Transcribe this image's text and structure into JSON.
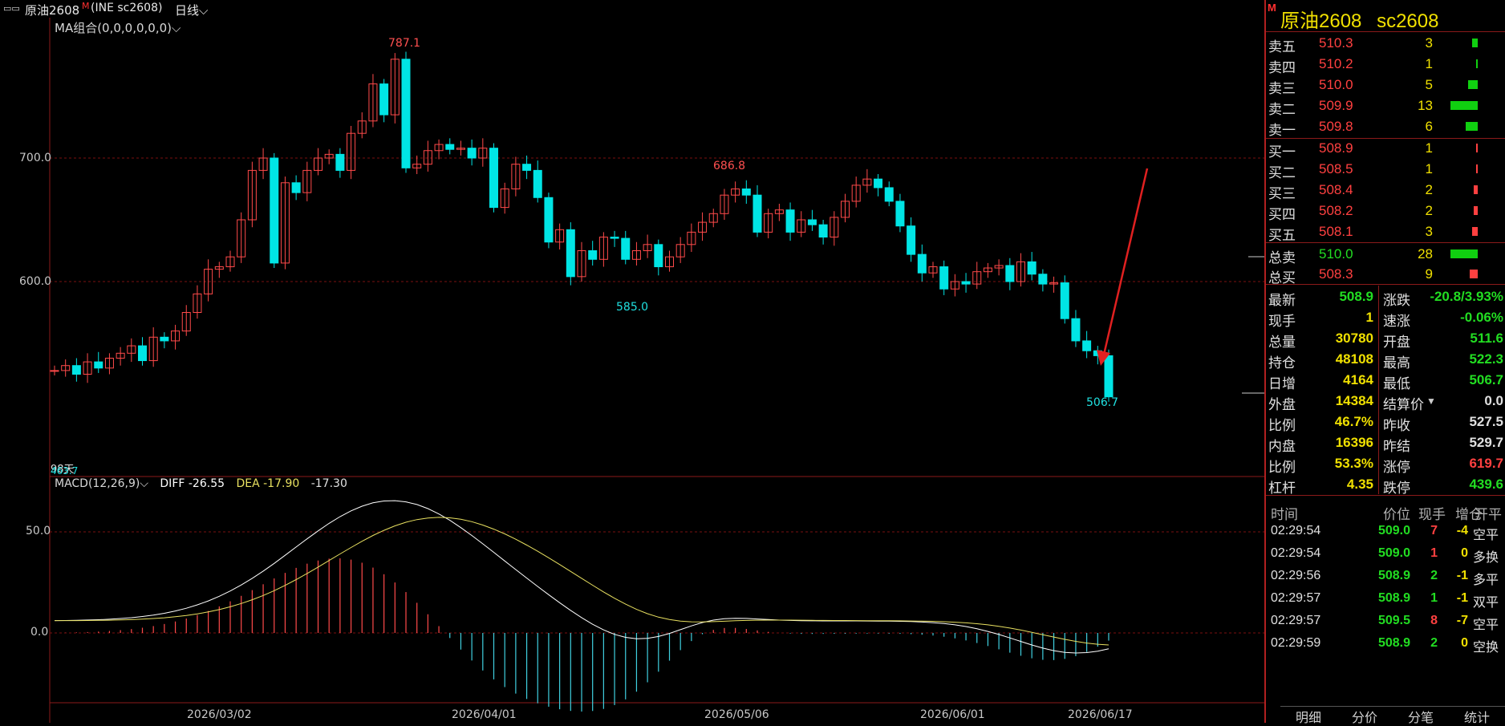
{
  "window": {
    "symbol_name": "原油2608",
    "marker": "M",
    "exchange_code": "(INE sc2608)",
    "period": "日线"
  },
  "main_chart": {
    "indicator_label": "MA组合(0,0,0,0,0,0)",
    "y_ticks": [
      "700.0",
      "600.0"
    ],
    "annotations": {
      "high_1": "787.1",
      "high_2": "686.8",
      "low_1": "585.0",
      "low_2": "506.7",
      "corner_1": "98天",
      "corner_2": "463.7"
    }
  },
  "macd": {
    "label": "MACD(12,26,9)",
    "diff_label": "DIFF -26.55",
    "dea_label": "DEA -17.90",
    "macd_value": "-17.30",
    "y_ticks": [
      "50.0",
      "0.0"
    ]
  },
  "x_axis": [
    "2026/03/02",
    "2026/04/01",
    "2026/05/06",
    "2026/06/01",
    "2026/06/17"
  ],
  "panel": {
    "title": "原油2608",
    "code": "sc2608",
    "marker": "M",
    "asks": [
      {
        "label": "卖五",
        "price": "510.3",
        "vol": "3",
        "bar": 0.2
      },
      {
        "label": "卖四",
        "price": "510.2",
        "vol": "1",
        "bar": 0.07
      },
      {
        "label": "卖三",
        "price": "510.0",
        "vol": "5",
        "bar": 0.35
      },
      {
        "label": "卖二",
        "price": "509.9",
        "vol": "13",
        "bar": 1.0
      },
      {
        "label": "卖一",
        "price": "509.8",
        "vol": "6",
        "bar": 0.45
      }
    ],
    "bids": [
      {
        "label": "买一",
        "price": "508.9",
        "vol": "1",
        "bar": 0.07
      },
      {
        "label": "买二",
        "price": "508.5",
        "vol": "1",
        "bar": 0.07
      },
      {
        "label": "买三",
        "price": "508.4",
        "vol": "2",
        "bar": 0.15
      },
      {
        "label": "买四",
        "price": "508.2",
        "vol": "2",
        "bar": 0.15
      },
      {
        "label": "买五",
        "price": "508.1",
        "vol": "3",
        "bar": 0.22
      }
    ],
    "totals": [
      {
        "label": "总卖",
        "price": "510.0",
        "vol": "28",
        "bar": 1.0
      },
      {
        "label": "总买",
        "price": "508.3",
        "vol": "9",
        "bar": 0.3
      }
    ],
    "stats": [
      {
        "l1": "最新",
        "v1": "508.9",
        "c1": "g",
        "l2": "涨跌",
        "v2": "-20.8/3.93%",
        "c2": "g"
      },
      {
        "l1": "现手",
        "v1": "1",
        "c1": "y",
        "l2": "速涨",
        "v2": "-0.06%",
        "c2": "g"
      },
      {
        "l1": "总量",
        "v1": "30780",
        "c1": "y",
        "l2": "开盘",
        "v2": "511.6",
        "c2": "g"
      },
      {
        "l1": "持仓",
        "v1": "48108",
        "c1": "y",
        "l2": "最高",
        "v2": "522.3",
        "c2": "g"
      },
      {
        "l1": "日增",
        "v1": "4164",
        "c1": "y",
        "l2": "最低",
        "v2": "506.7",
        "c2": "g"
      },
      {
        "l1": "外盘",
        "v1": "14384",
        "c1": "y",
        "l2": "结算价",
        "v2": "0.0",
        "c2": "w"
      },
      {
        "l1": "比例",
        "v1": "46.7%",
        "c1": "y",
        "l2": "昨收",
        "v2": "527.5",
        "c2": "w"
      },
      {
        "l1": "内盘",
        "v1": "16396",
        "c1": "y",
        "l2": "昨结",
        "v2": "529.7",
        "c2": "w"
      },
      {
        "l1": "比例",
        "v1": "53.3%",
        "c1": "y",
        "l2": "涨停",
        "v2": "619.7",
        "c2": "r"
      },
      {
        "l1": "杠杆",
        "v1": "4.35",
        "c1": "y",
        "l2": "跌停",
        "v2": "439.6",
        "c2": "g"
      }
    ],
    "ticks_header": {
      "time": "时间",
      "price": "价位",
      "qty": "现手",
      "oi": "增仓",
      "type": "开平"
    },
    "ticks": [
      {
        "time": "02:29:54",
        "price": "509.0",
        "qty": "7",
        "qc": "r",
        "oi": "-4",
        "type": "空平"
      },
      {
        "time": "02:29:54",
        "price": "509.0",
        "qty": "1",
        "qc": "r",
        "oi": "0",
        "type": "多换"
      },
      {
        "time": "02:29:56",
        "price": "508.9",
        "qty": "2",
        "qc": "g",
        "oi": "-1",
        "type": "多平"
      },
      {
        "time": "02:29:57",
        "price": "508.9",
        "qty": "1",
        "qc": "g",
        "oi": "-1",
        "type": "双平"
      },
      {
        "time": "02:29:57",
        "price": "509.5",
        "qty": "8",
        "qc": "r",
        "oi": "-7",
        "type": "空平"
      },
      {
        "time": "02:29:59",
        "price": "508.9",
        "qty": "2",
        "qc": "g",
        "oi": "0",
        "type": "空换"
      }
    ],
    "tabs": [
      "明细",
      "分价",
      "分笔",
      "统计"
    ]
  },
  "colors": {
    "up": "#ff4a4a",
    "down": "#00e5e5",
    "diff": "#ffffff",
    "dea": "#e8e060",
    "grid": "#7a1010",
    "arrow": "#e02020"
  }
}
